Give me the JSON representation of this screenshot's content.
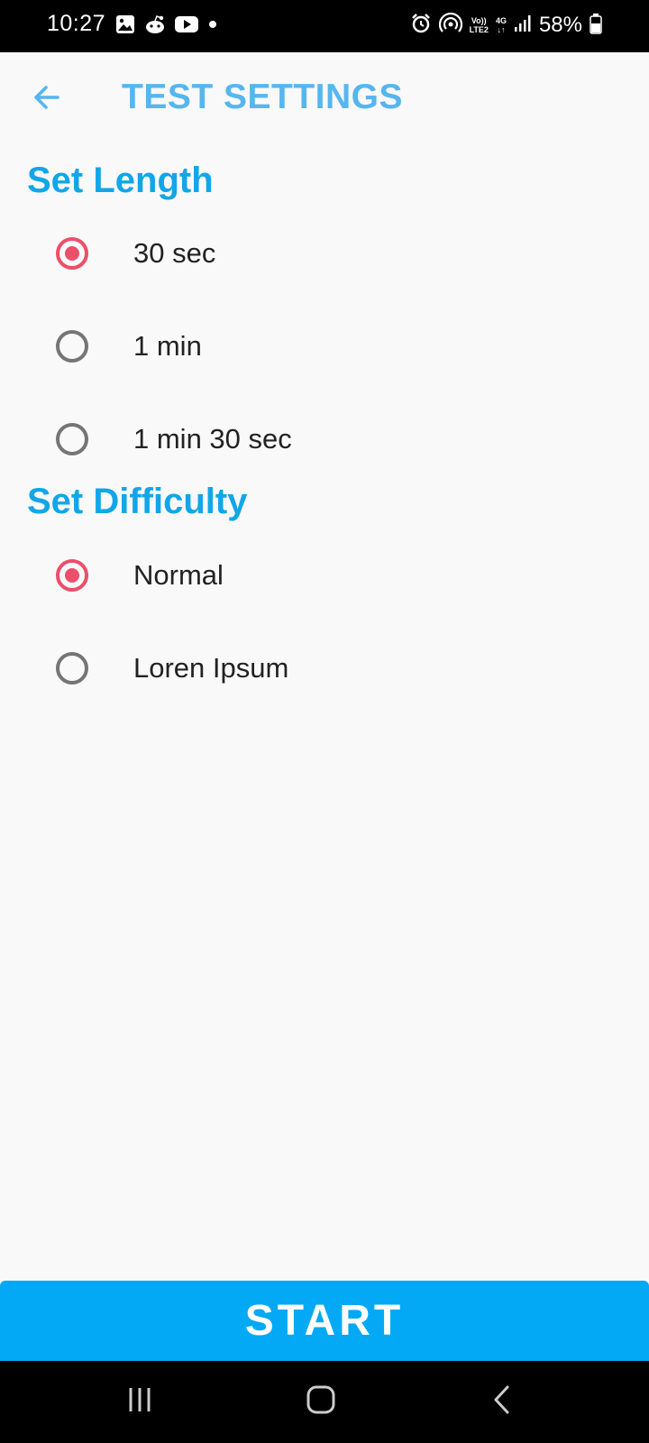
{
  "status_bar": {
    "time": "10:27",
    "left_icons": [
      "gallery-icon",
      "reddit-icon",
      "youtube-icon",
      "dot-icon"
    ],
    "right_icons": [
      "alarm-icon",
      "hotspot-icon",
      "volte-icon",
      "4g-icon",
      "signal-icon",
      "battery-icon"
    ],
    "volte_top": "Vo))",
    "volte_bottom": "LTE2",
    "network_type": "4G",
    "battery_percent": "58%"
  },
  "app_bar": {
    "back_icon": "arrow-left-icon",
    "title": "TEST SETTINGS"
  },
  "length_section": {
    "heading": "Set Length",
    "selected": "30 sec",
    "options": [
      {
        "label": "30 sec",
        "checked": true
      },
      {
        "label": "1 min",
        "checked": false
      },
      {
        "label": "1 min 30 sec",
        "checked": false
      }
    ]
  },
  "difficulty_section": {
    "heading": "Set Difficulty",
    "selected": "Normal",
    "options": [
      {
        "label": "Normal",
        "checked": true
      },
      {
        "label": "Loren Ipsum",
        "checked": false
      }
    ]
  },
  "start_button": {
    "label": "START"
  },
  "nav_bar": {
    "buttons": [
      "recents-icon",
      "home-icon",
      "back-icon"
    ]
  },
  "colors": {
    "accent_blue": "#12a6e8",
    "title_blue": "#56b6ef",
    "button_blue": "#03a9f4",
    "radio_checked": "#ec4f69",
    "radio_unchecked": "#757575",
    "background": "#f9f9f9"
  }
}
